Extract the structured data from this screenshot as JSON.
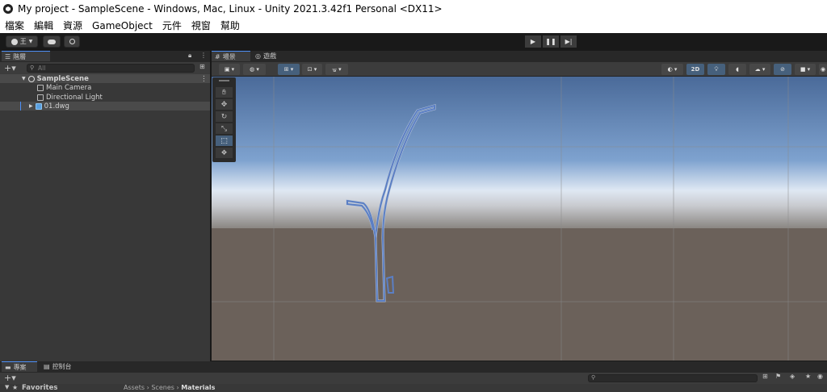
{
  "window": {
    "title": "My project - SampleScene - Windows, Mac, Linux - Unity 2021.3.42f1 Personal <DX11>"
  },
  "menu": {
    "items": [
      "檔案",
      "編輯",
      "資源",
      "GameObject",
      "元件",
      "視窗",
      "幫助"
    ]
  },
  "toolbar": {
    "account_label": "王",
    "play_icon": "play-icon",
    "pause_icon": "pause-icon",
    "step_icon": "step-icon"
  },
  "hierarchy": {
    "tab_label": "階層",
    "search_placeholder": "All",
    "scene_name": "SampleScene",
    "items": [
      "Main Camera",
      "Directional Light",
      "01.dwg"
    ]
  },
  "scene": {
    "tab_scene": "場景",
    "tab_game": "遊戲",
    "mode_2d": "2D"
  },
  "project": {
    "tab_project": "專案",
    "tab_console": "控制台",
    "favorites": "Favorites",
    "breadcrumb": [
      "Assets",
      "Scenes",
      "Materials"
    ],
    "count": "9"
  },
  "colors": {
    "accent": "#4d8ff7",
    "selection": "#46607c",
    "sky": "#5a7aa8",
    "ground": "#6a5f58"
  }
}
